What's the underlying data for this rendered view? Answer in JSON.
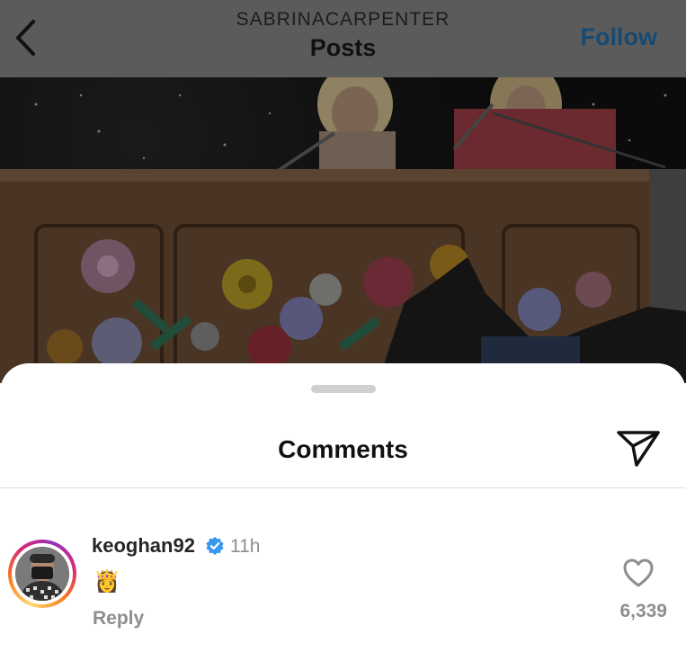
{
  "header": {
    "account_name": "SABRINACARPENTER",
    "title": "Posts",
    "follow_label": "Follow"
  },
  "icons": {
    "back": "chevron-left-icon",
    "share": "paper-plane-icon",
    "verified": "verified-badge-icon",
    "like": "heart-icon"
  },
  "comments_sheet": {
    "title": "Comments",
    "comments": [
      {
        "username": "keoghan92",
        "verified": true,
        "time": "11h",
        "text": "👸",
        "reply_label": "Reply",
        "likes": "6,339"
      }
    ]
  },
  "colors": {
    "follow": "#174a73",
    "verified": "#3897f0",
    "secondary_text": "#8e8e8e"
  }
}
